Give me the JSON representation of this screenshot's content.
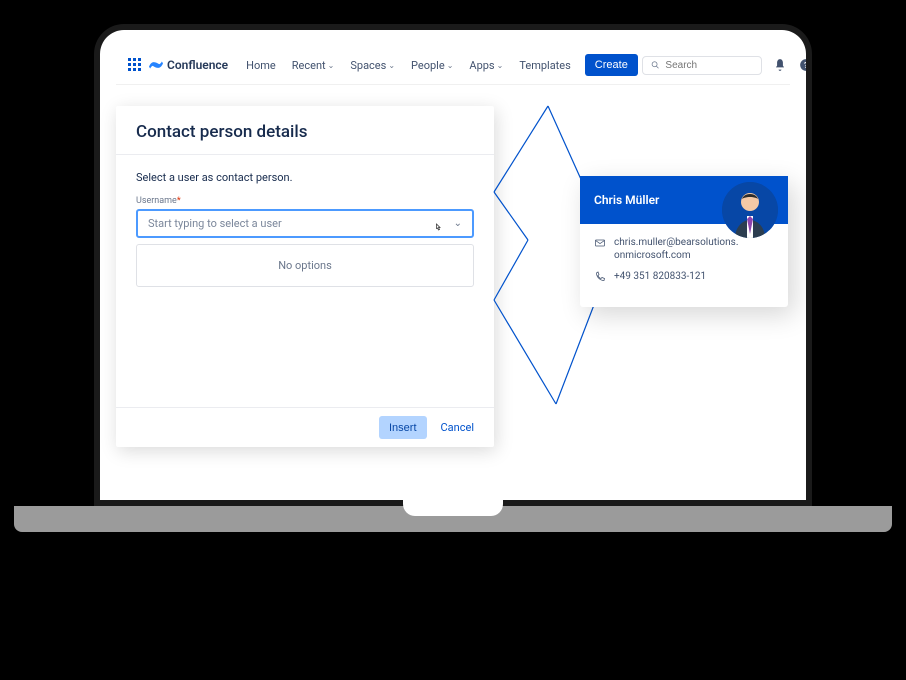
{
  "app": {
    "name": "Confluence"
  },
  "nav": {
    "home": "Home",
    "recent": "Recent",
    "spaces": "Spaces",
    "people": "People",
    "apps": "Apps",
    "templates": "Templates",
    "create": "Create",
    "search_placeholder": "Search"
  },
  "dialog": {
    "title": "Contact person details",
    "instruction": "Select a user as contact person.",
    "username_label": "Username",
    "placeholder": "Start typing to select a user",
    "no_options": "No options",
    "insert": "Insert",
    "cancel": "Cancel"
  },
  "card": {
    "name": "Chris Müller",
    "email": "chris.muller@bearsolutions.onmicrosoft.com",
    "phone": "+49 351 820833-121"
  }
}
